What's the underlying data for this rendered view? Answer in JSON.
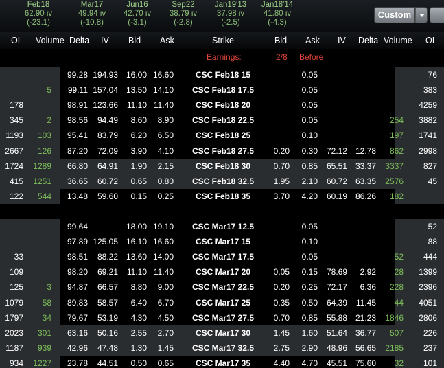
{
  "expirations": [
    {
      "name": "Feb18",
      "iv": "62.90 iv",
      "chg": "(-23.1)"
    },
    {
      "name": "Mar17",
      "iv": "49.94 iv",
      "chg": "(-10.8)"
    },
    {
      "name": "Jun16",
      "iv": "42.70 iv",
      "chg": "(-3.1)"
    },
    {
      "name": "Sep22",
      "iv": "38.79 iv",
      "chg": "(-2.8)"
    },
    {
      "name": "Jan19'13",
      "iv": "37.98 iv",
      "chg": "(-2.5)"
    },
    {
      "name": "Jan18'14",
      "iv": "41.80 iv",
      "chg": "(-4.3)"
    }
  ],
  "toolbar": {
    "custom_label": "Custom"
  },
  "columns": {
    "calls": [
      "OI",
      "Volume",
      "Delta",
      "IV",
      "Bid",
      "Ask"
    ],
    "strike": "Strike",
    "puts": [
      "Bid",
      "Ask",
      "IV",
      "Delta",
      "Volume",
      "OI"
    ]
  },
  "earnings": {
    "label": "Earnings:",
    "date": "2/8",
    "timing": "Before"
  },
  "rows": [
    {
      "c_oi": "",
      "c_vol": "",
      "c_delta": "99.28",
      "c_iv": "194.93",
      "c_bid": "16.00",
      "c_ask": "16.60",
      "strike": "CSC Feb18 15",
      "p_bid": "",
      "p_ask": "0.05",
      "p_iv": "",
      "p_delta": "",
      "p_vol": "",
      "p_oi": "76"
    },
    {
      "c_oi": "",
      "c_vol": "5",
      "c_delta": "99.11",
      "c_iv": "157.04",
      "c_bid": "13.50",
      "c_ask": "14.10",
      "strike": "CSC Feb18 17.5",
      "p_bid": "",
      "p_ask": "0.05",
      "p_iv": "",
      "p_delta": "",
      "p_vol": "",
      "p_oi": "383"
    },
    {
      "c_oi": "178",
      "c_vol": "",
      "c_delta": "98.91",
      "c_iv": "123.66",
      "c_bid": "11.10",
      "c_ask": "11.40",
      "strike": "CSC Feb18 20",
      "p_bid": "",
      "p_ask": "0.05",
      "p_iv": "",
      "p_delta": "",
      "p_vol": "",
      "p_oi": "4259"
    },
    {
      "c_oi": "345",
      "c_vol": "2",
      "c_delta": "98.56",
      "c_iv": "94.49",
      "c_bid": "8.60",
      "c_ask": "8.90",
      "strike": "CSC Feb18 22.5",
      "p_bid": "",
      "p_ask": "0.05",
      "p_iv": "",
      "p_delta": "",
      "p_vol": "254",
      "p_oi": "3882"
    },
    {
      "c_oi": "1193",
      "c_vol": "103",
      "c_delta": "95.41",
      "c_iv": "83.79",
      "c_bid": "6.20",
      "c_ask": "6.50",
      "strike": "CSC Feb18 25",
      "p_bid": "",
      "p_ask": "0.10",
      "p_iv": "",
      "p_delta": "",
      "p_vol": "197",
      "p_oi": "1741"
    },
    {
      "c_oi": "2667",
      "c_vol": "126",
      "c_delta": "87.20",
      "c_iv": "72.09",
      "c_bid": "3.90",
      "c_ask": "4.10",
      "strike": "CSC Feb18 27.5",
      "p_bid": "0.20",
      "p_ask": "0.30",
      "p_iv": "72.12",
      "p_delta": "12.78",
      "p_vol": "862",
      "p_oi": "2998"
    },
    {
      "c_oi": "1724",
      "c_vol": "1289",
      "c_delta": "66.80",
      "c_iv": "64.91",
      "c_bid": "1.90",
      "c_ask": "2.15",
      "strike": "CSC Feb18 30",
      "p_bid": "0.70",
      "p_ask": "0.85",
      "p_iv": "65.51",
      "p_delta": "33.37",
      "p_vol": "3337",
      "p_oi": "827"
    },
    {
      "c_oi": "415",
      "c_vol": "1251",
      "c_delta": "36.65",
      "c_iv": "60.72",
      "c_bid": "0.65",
      "c_ask": "0.80",
      "strike": "CSC Feb18 32.5",
      "p_bid": "1.95",
      "p_ask": "2.10",
      "p_iv": "60.72",
      "p_delta": "63.35",
      "p_vol": "2576",
      "p_oi": "45"
    },
    {
      "c_oi": "122",
      "c_vol": "544",
      "c_delta": "13.48",
      "c_iv": "59.60",
      "c_bid": "0.15",
      "c_ask": "0.25",
      "strike": "CSC Feb18 35",
      "p_bid": "3.70",
      "p_ask": "4.20",
      "p_iv": "60.19",
      "p_delta": "86.26",
      "p_vol": "182",
      "p_oi": ""
    },
    {
      "c_oi": "",
      "c_vol": "",
      "c_delta": "",
      "c_iv": "",
      "c_bid": "",
      "c_ask": "",
      "strike": "",
      "p_bid": "",
      "p_ask": "",
      "p_iv": "",
      "p_delta": "",
      "p_vol": "",
      "p_oi": ""
    },
    {
      "c_oi": "",
      "c_vol": "",
      "c_delta": "99.64",
      "c_iv": "",
      "c_bid": "18.00",
      "c_ask": "19.10",
      "strike": "CSC Mar17 12.5",
      "p_bid": "",
      "p_ask": "0.05",
      "p_iv": "",
      "p_delta": "",
      "p_vol": "",
      "p_oi": "52"
    },
    {
      "c_oi": "",
      "c_vol": "",
      "c_delta": "97.89",
      "c_iv": "125.05",
      "c_bid": "16.10",
      "c_ask": "16.60",
      "strike": "CSC Mar17 15",
      "p_bid": "",
      "p_ask": "0.10",
      "p_iv": "",
      "p_delta": "",
      "p_vol": "",
      "p_oi": "88"
    },
    {
      "c_oi": "33",
      "c_vol": "",
      "c_delta": "98.51",
      "c_iv": "88.22",
      "c_bid": "13.60",
      "c_ask": "14.00",
      "strike": "CSC Mar17 17.5",
      "p_bid": "",
      "p_ask": "0.05",
      "p_iv": "",
      "p_delta": "",
      "p_vol": "52",
      "p_oi": "444"
    },
    {
      "c_oi": "109",
      "c_vol": "",
      "c_delta": "98.20",
      "c_iv": "69.21",
      "c_bid": "11.10",
      "c_ask": "11.40",
      "strike": "CSC Mar17 20",
      "p_bid": "0.05",
      "p_ask": "0.15",
      "p_iv": "78.69",
      "p_delta": "2.92",
      "p_vol": "28",
      "p_oi": "1399"
    },
    {
      "c_oi": "125",
      "c_vol": "3",
      "c_delta": "94.87",
      "c_iv": "66.57",
      "c_bid": "8.80",
      "c_ask": "9.00",
      "strike": "CSC Mar17 22.5",
      "p_bid": "0.20",
      "p_ask": "0.25",
      "p_iv": "72.17",
      "p_delta": "6.36",
      "p_vol": "228",
      "p_oi": "2396"
    },
    {
      "c_oi": "1079",
      "c_vol": "58",
      "c_delta": "89.83",
      "c_iv": "58.57",
      "c_bid": "6.40",
      "c_ask": "6.70",
      "strike": "CSC Mar17 25",
      "p_bid": "0.35",
      "p_ask": "0.50",
      "p_iv": "64.39",
      "p_delta": "11.45",
      "p_vol": "44",
      "p_oi": "4051"
    },
    {
      "c_oi": "1797",
      "c_vol": "34",
      "c_delta": "79.67",
      "c_iv": "53.19",
      "c_bid": "4.30",
      "c_ask": "4.50",
      "strike": "CSC Mar17 27.5",
      "p_bid": "0.70",
      "p_ask": "0.85",
      "p_iv": "55.88",
      "p_delta": "21.23",
      "p_vol": "1846",
      "p_oi": "2806"
    },
    {
      "c_oi": "2023",
      "c_vol": "301",
      "c_delta": "63.16",
      "c_iv": "50.16",
      "c_bid": "2.55",
      "c_ask": "2.70",
      "strike": "CSC Mar17 30",
      "p_bid": "1.45",
      "p_ask": "1.60",
      "p_iv": "51.64",
      "p_delta": "36.77",
      "p_vol": "507",
      "p_oi": "226"
    },
    {
      "c_oi": "1187",
      "c_vol": "939",
      "c_delta": "42.96",
      "c_iv": "47.48",
      "c_bid": "1.30",
      "c_ask": "1.45",
      "strike": "CSC Mar17 32.5",
      "p_bid": "2.75",
      "p_ask": "2.90",
      "p_iv": "48.96",
      "p_delta": "56.65",
      "p_vol": "2185",
      "p_oi": "237"
    },
    {
      "c_oi": "934",
      "c_vol": "1227",
      "c_delta": "23.78",
      "c_iv": "44.51",
      "c_bid": "0.50",
      "c_ask": "0.65",
      "strike": "CSC Mar17 35",
      "p_bid": "4.40",
      "p_ask": "4.70",
      "p_iv": "45.51",
      "p_delta": "75.60",
      "p_vol": "32",
      "p_oi": "101"
    }
  ],
  "colors": {
    "background": "#000000",
    "volume_text": "#7dbe5a",
    "earnings_text": "#e0443a",
    "band_row": "#2a2d30"
  }
}
